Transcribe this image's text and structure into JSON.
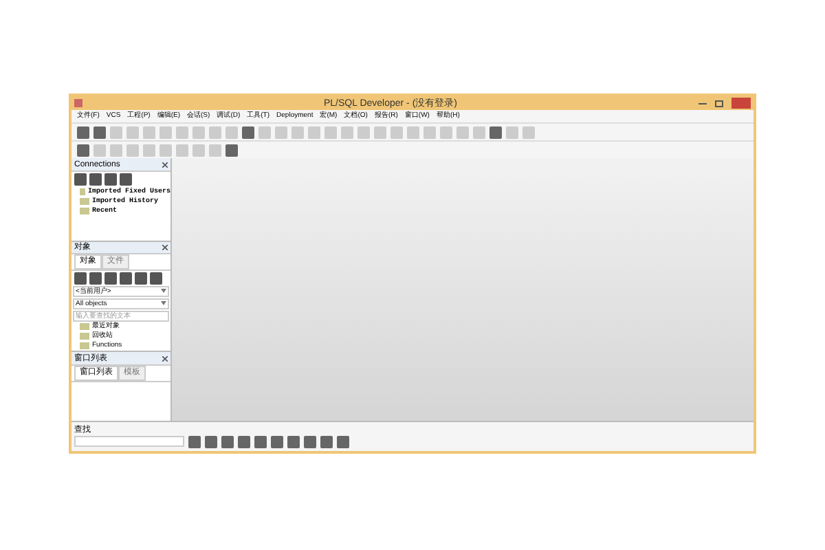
{
  "window": {
    "title": "PL/SQL Developer - (没有登录)"
  },
  "menu": [
    "文件(F)",
    "VCS",
    "工程(P)",
    "编辑(E)",
    "会话(S)",
    "调试(D)",
    "工具(T)",
    "Deployment",
    "宏(M)",
    "文档(O)",
    "报告(R)",
    "窗口(W)",
    "帮助(H)"
  ],
  "connections": {
    "title": "Connections",
    "items": [
      {
        "label": "Imported Fixed Users"
      },
      {
        "label": "Imported History"
      },
      {
        "label": "Recent"
      }
    ]
  },
  "objects": {
    "title": "对象",
    "tabs": [
      {
        "label": "对象",
        "selected": true
      },
      {
        "label": "文件",
        "selected": false
      }
    ],
    "user_select": "<当前用户>",
    "filter_select": "All objects",
    "search": {
      "placeholder": "输入要查找的文本"
    },
    "items": [
      {
        "label": "最近对象"
      },
      {
        "label": "回收站"
      },
      {
        "label": "Functions"
      }
    ]
  },
  "window_list": {
    "title": "窗口列表",
    "tabs": [
      {
        "label": "窗口列表",
        "selected": true
      },
      {
        "label": "模板",
        "selected": false
      }
    ]
  },
  "find": {
    "label": "查找"
  }
}
